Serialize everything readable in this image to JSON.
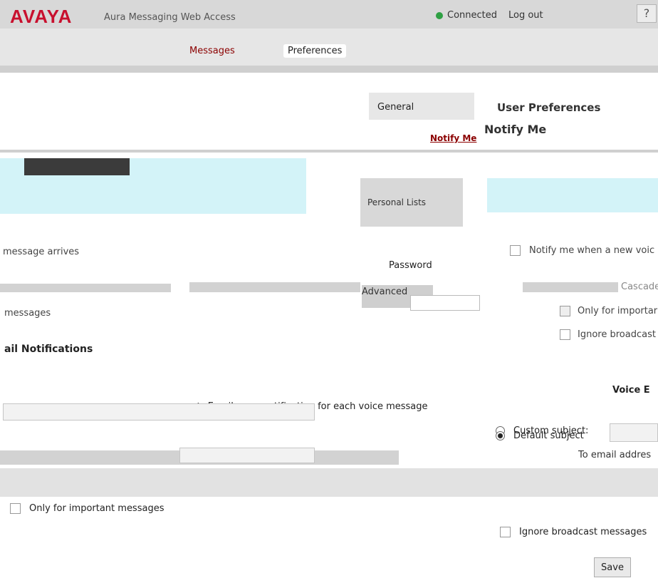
{
  "header": {
    "logo": "AVAYA",
    "app_title": "Aura Messaging Web Access",
    "status": "Connected",
    "logout": "Log out",
    "help": "?"
  },
  "nav": {
    "tabs": [
      {
        "label": "Messages"
      },
      {
        "label": "Preferences"
      }
    ]
  },
  "sidebar": {
    "items": [
      {
        "label": "General"
      },
      {
        "label": "Notify Me"
      },
      {
        "label": "Personal Lists"
      },
      {
        "label": "Password"
      },
      {
        "label": "Advanced"
      }
    ]
  },
  "content": {
    "section_title": "User Preferences",
    "page_heading": "Notify Me",
    "phone": {
      "message_arrives": "message arrives",
      "notify_new_voice": "Notify me when a new voic",
      "cascade": "Cascade",
      "messages": "messages",
      "only_important_right": "Only for importar",
      "ignore_broadcast_right": "Ignore broadcast"
    },
    "email": {
      "heading": "ail Notifications",
      "voice_label": "Voice E",
      "email_each_voice": "Email me a notification for each voice message",
      "custom_subject": "Custom subject:",
      "default_subject": "Default subject",
      "to_email": "To email addres",
      "only_important": "Only for important messages",
      "ignore_broadcast": "Ignore broadcast messages"
    },
    "save": "Save"
  },
  "colors": {
    "brand": "#c8102e",
    "active_link": "#8b0000",
    "info_bg": "#d3f3f8",
    "status_green": "#2ea043"
  }
}
